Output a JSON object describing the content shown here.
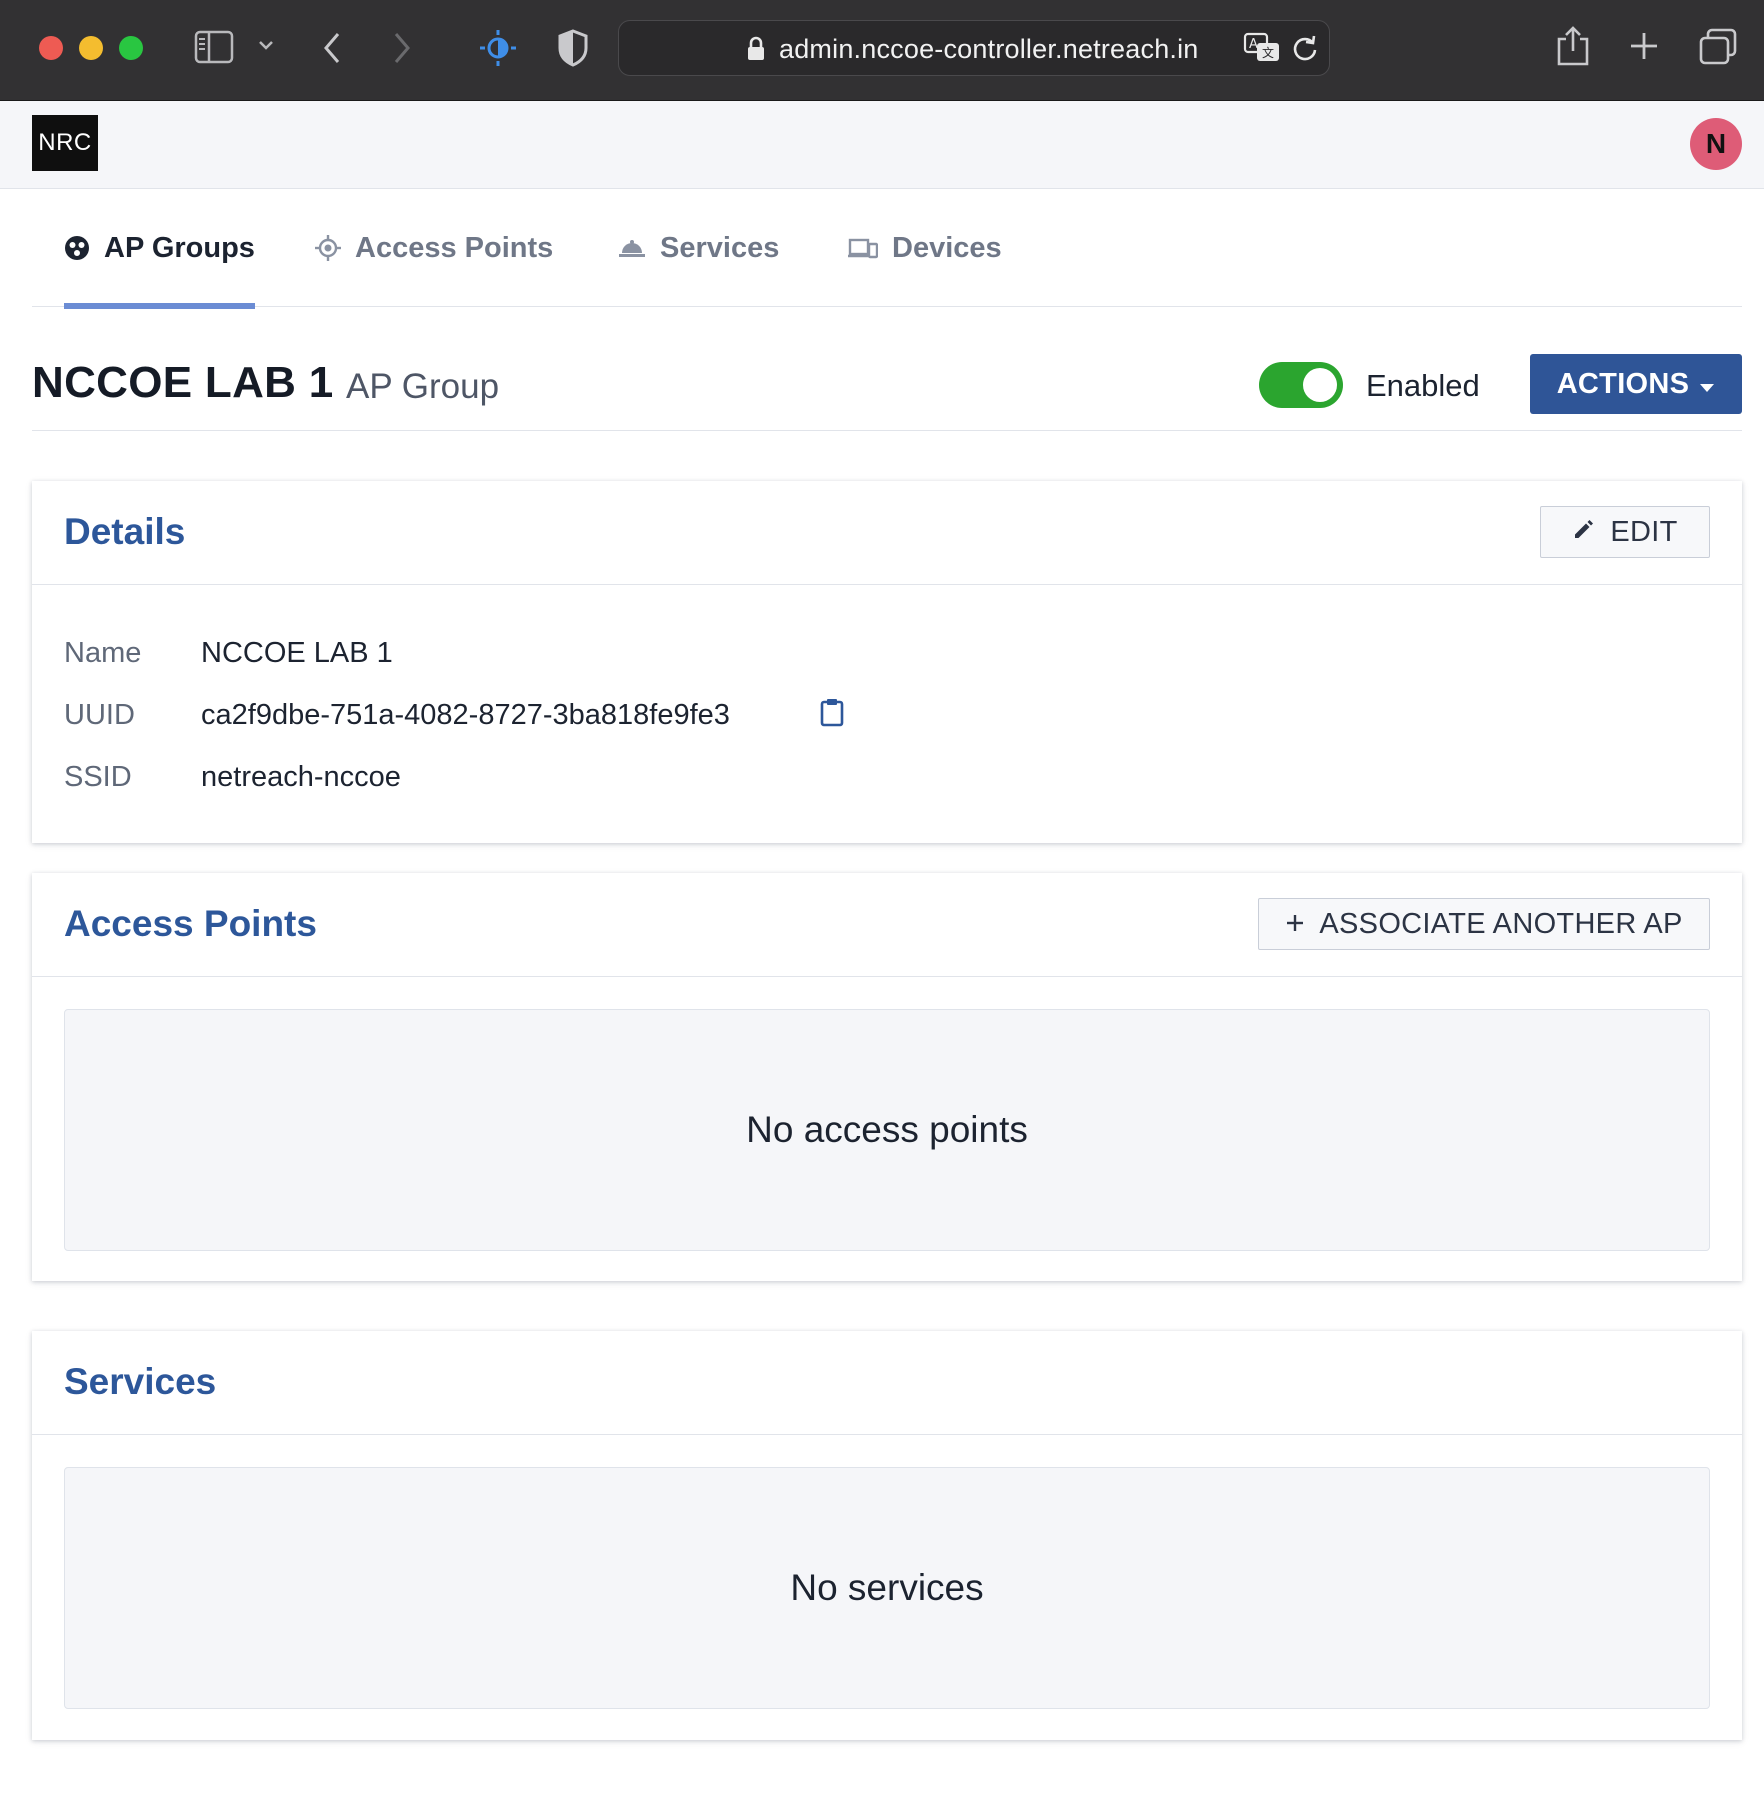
{
  "browser": {
    "url": "admin.nccoe-controller.netreach.in"
  },
  "app": {
    "logo": "NRC",
    "avatar_initial": "N"
  },
  "tabs": [
    {
      "label": "AP Groups",
      "icon": "ap-groups-icon",
      "active": true
    },
    {
      "label": "Access Points",
      "icon": "access-point-icon",
      "active": false
    },
    {
      "label": "Services",
      "icon": "services-icon",
      "active": false
    },
    {
      "label": "Devices",
      "icon": "devices-icon",
      "active": false
    }
  ],
  "page": {
    "title": "NCCOE LAB 1",
    "subtitle": "AP Group",
    "enabled": true,
    "toggle_label": "Enabled",
    "actions_label": "ACTIONS"
  },
  "details": {
    "title": "Details",
    "edit_label": "EDIT",
    "fields": [
      {
        "label": "Name",
        "value": "NCCOE LAB 1"
      },
      {
        "label": "UUID",
        "value": "ca2f9dbe-751a-4082-8727-3ba818fe9fe3"
      },
      {
        "label": "SSID",
        "value": "netreach-nccoe"
      }
    ]
  },
  "access_points": {
    "title": "Access Points",
    "associate_label": "ASSOCIATE ANOTHER AP",
    "empty_text": "No access points"
  },
  "services": {
    "title": "Services",
    "empty_text": "No services"
  },
  "colors": {
    "primary": "#2f5597",
    "card_title": "#2d579a",
    "toggle_on": "#2ba52f",
    "tab_indicator": "#6b8cd4",
    "avatar": "#de5c77"
  }
}
